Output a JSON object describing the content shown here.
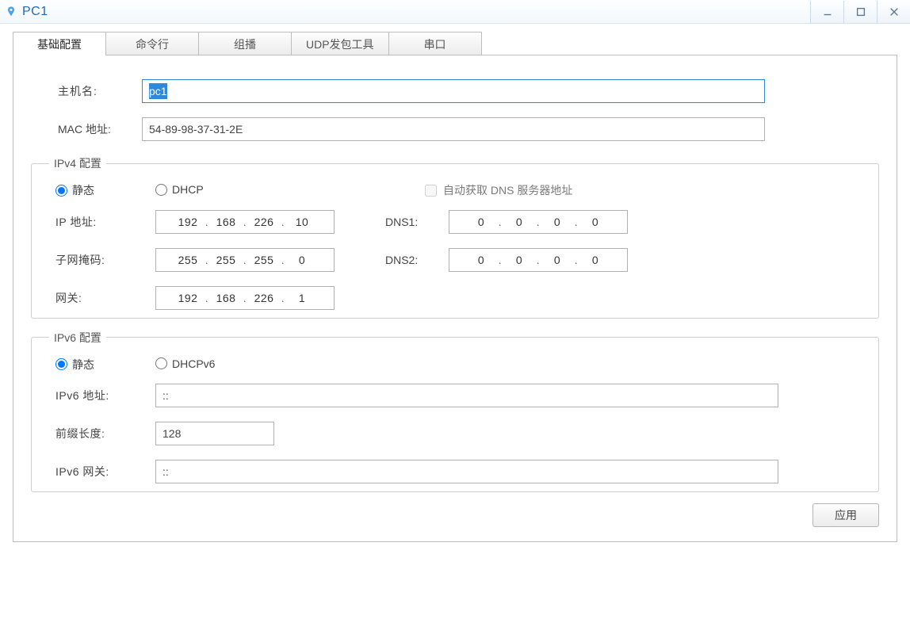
{
  "window": {
    "title": "PC1"
  },
  "tabs": [
    {
      "label": "基础配置",
      "active": true
    },
    {
      "label": "命令行",
      "active": false
    },
    {
      "label": "组播",
      "active": false
    },
    {
      "label": "UDP发包工具",
      "active": false
    },
    {
      "label": "串口",
      "active": false
    }
  ],
  "form": {
    "hostname_label": "主机名:",
    "hostname_value": "pc1",
    "mac_label": "MAC 地址:",
    "mac_value": "54-89-98-37-31-2E"
  },
  "ipv4": {
    "legend": "IPv4 配置",
    "radio_static": "静态",
    "radio_dhcp": "DHCP",
    "auto_dns_label": "自动获取 DNS 服务器地址",
    "mode": "static",
    "auto_dns_checked": false,
    "ip_label": "IP 地址:",
    "ip": [
      "192",
      "168",
      "226",
      "10"
    ],
    "mask_label": "子网掩码:",
    "mask": [
      "255",
      "255",
      "255",
      "0"
    ],
    "gw_label": "网关:",
    "gateway": [
      "192",
      "168",
      "226",
      "1"
    ],
    "dns1_label": "DNS1:",
    "dns1": [
      "0",
      "0",
      "0",
      "0"
    ],
    "dns2_label": "DNS2:",
    "dns2": [
      "0",
      "0",
      "0",
      "0"
    ]
  },
  "ipv6": {
    "legend": "IPv6 配置",
    "radio_static": "静态",
    "radio_dhcp": "DHCPv6",
    "mode": "static",
    "addr_label": "IPv6 地址:",
    "addr": "::",
    "prefix_label": "前缀长度:",
    "prefix": "128",
    "gw_label": "IPv6 网关:",
    "gateway": "::"
  },
  "buttons": {
    "apply": "应用"
  }
}
